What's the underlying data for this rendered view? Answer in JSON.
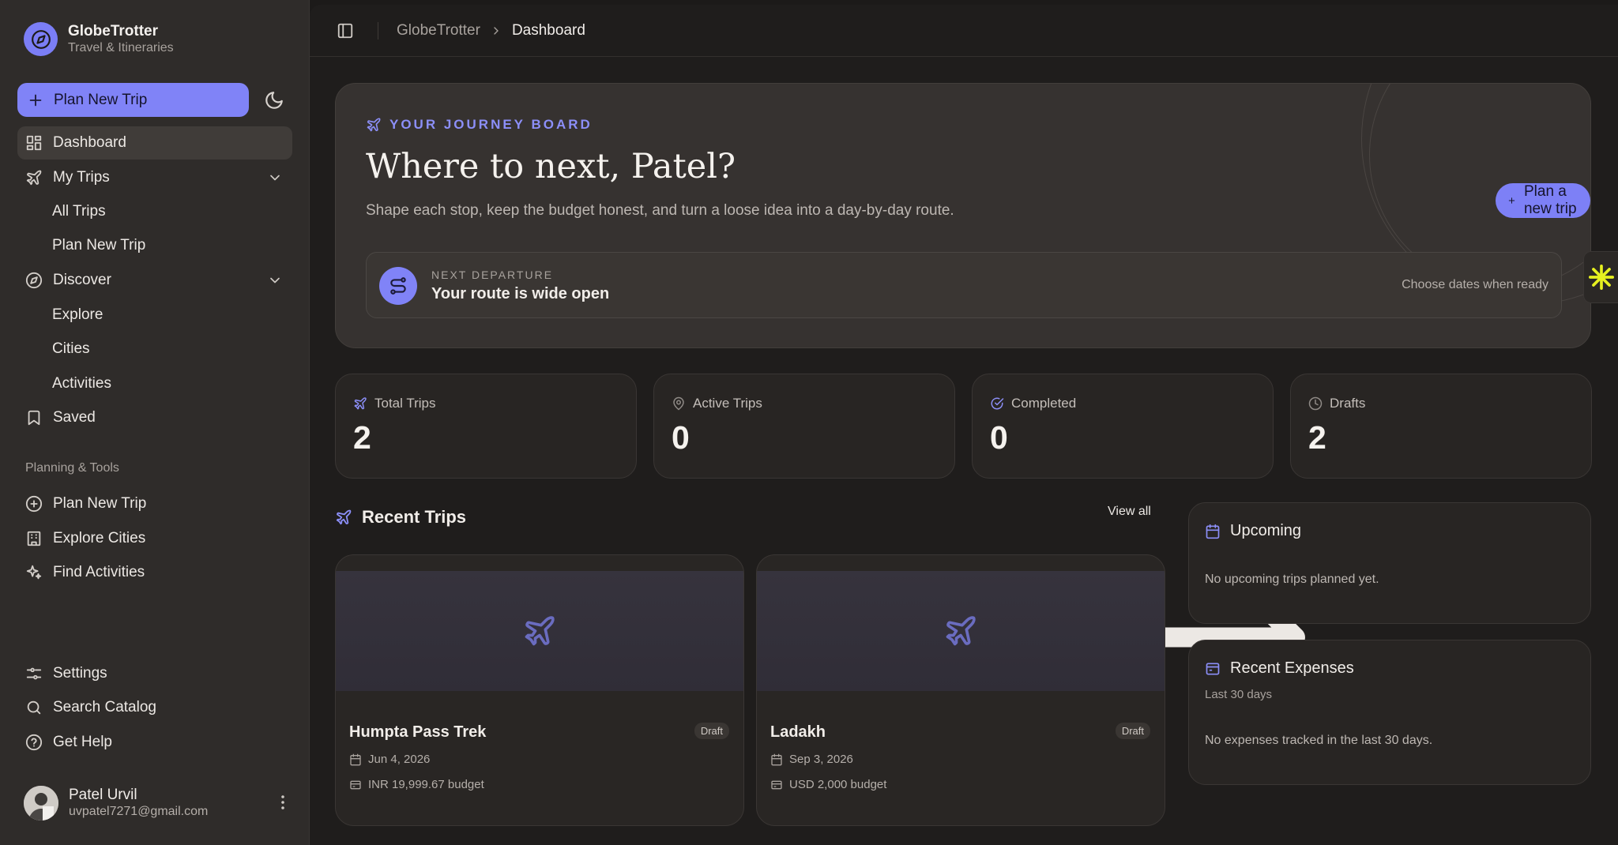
{
  "brand": {
    "name": "GlobeTrotter",
    "subtitle": "Travel & Itineraries"
  },
  "sidebar": {
    "plan_button": "Plan New Trip",
    "nav": [
      {
        "label": "Dashboard",
        "icon": "dashboard-icon",
        "active": true
      },
      {
        "label": "My Trips",
        "icon": "plane-icon",
        "expanded": true,
        "children": [
          "All Trips",
          "Plan New Trip"
        ]
      },
      {
        "label": "Discover",
        "icon": "compass-icon",
        "expanded": true,
        "children": [
          "Explore",
          "Cities",
          "Activities"
        ]
      },
      {
        "label": "Saved",
        "icon": "bookmark-icon"
      }
    ],
    "section_label": "Planning & Tools",
    "tools": [
      {
        "label": "Plan New Trip",
        "icon": "plus-circle-icon"
      },
      {
        "label": "Explore Cities",
        "icon": "building-icon"
      },
      {
        "label": "Find Activities",
        "icon": "sparkles-icon"
      }
    ],
    "footer": [
      {
        "label": "Settings",
        "icon": "sliders-icon"
      },
      {
        "label": "Search Catalog",
        "icon": "search-icon"
      },
      {
        "label": "Get Help",
        "icon": "help-icon"
      }
    ],
    "user": {
      "name": "Patel Urvil",
      "email": "uvpatel7271@gmail.com"
    }
  },
  "breadcrumb": {
    "root": "GlobeTrotter",
    "current": "Dashboard"
  },
  "hero": {
    "eyebrow": "YOUR JOURNEY BOARD",
    "title": "Where to next, Patel?",
    "subtitle": "Shape each stop, keep the budget honest, and turn a loose idea into a day-by-day route.",
    "cta": "Plan a new trip",
    "departure": {
      "eyebrow": "NEXT DEPARTURE",
      "title": "Your route is wide open",
      "hint": "Choose dates when ready"
    }
  },
  "stats": [
    {
      "label": "Total Trips",
      "value": "2",
      "icon": "plane-icon"
    },
    {
      "label": "Active Trips",
      "value": "0",
      "icon": "map-pin-icon"
    },
    {
      "label": "Completed",
      "value": "0",
      "icon": "check-circle-icon"
    },
    {
      "label": "Drafts",
      "value": "2",
      "icon": "clock-icon"
    }
  ],
  "recent_trips": {
    "title": "Recent Trips",
    "view_all": "View all",
    "trips": [
      {
        "name": "Humpta Pass Trek",
        "status": "Draft",
        "date": "Jun 4, 2026",
        "budget": "INR 19,999.67 budget"
      },
      {
        "name": "Ladakh",
        "status": "Draft",
        "date": "Sep 3, 2026",
        "budget": "USD 2,000 budget"
      }
    ]
  },
  "upcoming": {
    "title": "Upcoming",
    "empty": "No upcoming trips planned yet."
  },
  "expenses": {
    "title": "Recent Expenses",
    "subtitle": "Last 30 days",
    "empty": "No expenses tracked in the last 30 days."
  },
  "colors": {
    "accent": "#8083f7",
    "background": "#1c1a19",
    "sidebar": "#2f2c2a",
    "card": "#282523",
    "widget": "#e6f020"
  }
}
